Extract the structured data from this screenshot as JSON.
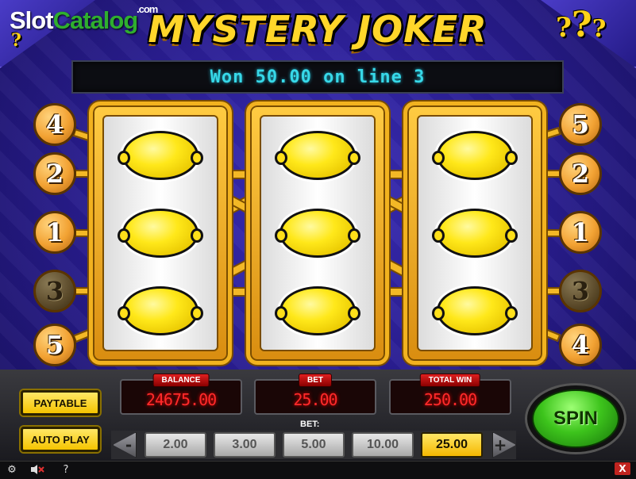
{
  "branding": {
    "watermark_part1": "Slot",
    "watermark_part2": "Catalog",
    "watermark_dotcom": ".com",
    "game_title": "MYSTERY JOKER"
  },
  "message": "Won 50.00 on line 3",
  "paylines": {
    "left": [
      {
        "number": "4",
        "active": true
      },
      {
        "number": "2",
        "active": true
      },
      {
        "number": "1",
        "active": true
      },
      {
        "number": "3",
        "active": false
      },
      {
        "number": "5",
        "active": true
      }
    ],
    "right": [
      {
        "number": "5",
        "active": true
      },
      {
        "number": "2",
        "active": true
      },
      {
        "number": "1",
        "active": true
      },
      {
        "number": "3",
        "active": false
      },
      {
        "number": "4",
        "active": true
      }
    ]
  },
  "reels": [
    [
      "lemon",
      "lemon",
      "lemon"
    ],
    [
      "lemon",
      "lemon",
      "lemon"
    ],
    [
      "lemon",
      "lemon",
      "lemon"
    ]
  ],
  "controls": {
    "paytable_label": "PAYTABLE",
    "autoplay_label": "AUTO PLAY",
    "spin_label": "SPIN",
    "bet_select_label": "BET:",
    "bet_decrease": "-",
    "bet_increase": "+",
    "bet_options": [
      "2.00",
      "3.00",
      "5.00",
      "10.00",
      "25.00"
    ],
    "selected_bet": "25.00"
  },
  "meters": {
    "balance_label": "BALANCE",
    "balance_value": "24675.00",
    "bet_label": "BET",
    "bet_value": "25.00",
    "total_win_label": "TOTAL WIN",
    "total_win_value": "250.00"
  },
  "statusbar": {
    "settings_icon": "gear-icon",
    "sound_icon": "sound-muted-icon",
    "help_label": "?",
    "close_label": "X"
  },
  "colors": {
    "background": "#2a1e93",
    "gold": "#f2b21f",
    "message_text": "#37d8e8",
    "meter_text": "#ff2a2a",
    "spin_green": "#3dc41c",
    "button_yellow": "#f5c400"
  }
}
